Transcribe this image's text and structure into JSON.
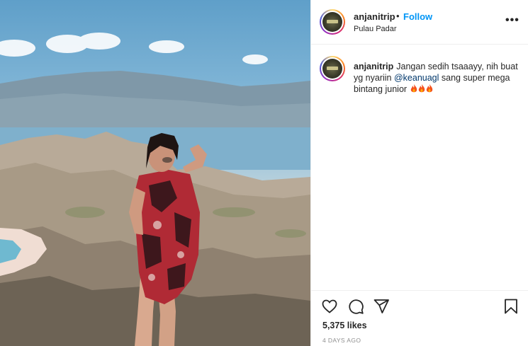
{
  "post": {
    "username": "anjanitrip",
    "separator": "•",
    "follow_label": "Follow",
    "location": "Pulau Padar",
    "more_label": "•••",
    "caption_username": "anjanitrip",
    "caption_text_1": "Jangan sedih tsaaayy, nih buat yg nyariin",
    "caption_mention": "@keanuagl",
    "caption_text_2": "sang super mega bintang junior",
    "caption_emoji": [
      "fire-emoji",
      "fire-emoji",
      "fire-emoji"
    ],
    "likes": "5,375 likes",
    "timestamp": "4 DAYS AGO"
  },
  "icons": {
    "like": "heart-icon",
    "comment": "comment-icon",
    "share": "paper-plane-icon",
    "save": "bookmark-icon"
  },
  "colors": {
    "follow": "#0095f6",
    "mention": "#00376b",
    "muted": "#8e8e8e",
    "text": "#262626"
  }
}
